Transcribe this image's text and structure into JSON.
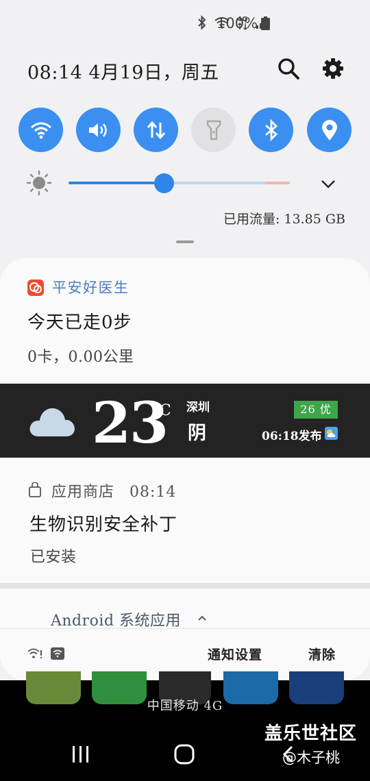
{
  "status_bar": {
    "battery_text": "100%",
    "icons": [
      "bluetooth-icon",
      "wifi-icon",
      "4g-icon",
      "signal-icon",
      "battery-icon"
    ]
  },
  "header": {
    "datetime": "08:14 4月19日，周五"
  },
  "quick_settings": {
    "tiles": [
      {
        "name": "wifi",
        "icon": "wifi-icon",
        "on": true
      },
      {
        "name": "sound",
        "icon": "speaker-icon",
        "on": true
      },
      {
        "name": "mobile-data",
        "icon": "data-arrows-icon",
        "on": true
      },
      {
        "name": "flashlight",
        "icon": "flashlight-icon",
        "on": false
      },
      {
        "name": "bluetooth",
        "icon": "bluetooth-icon",
        "on": true
      },
      {
        "name": "location",
        "icon": "location-pin-icon",
        "on": true
      }
    ],
    "brightness_level": 0.43,
    "data_usage": "已用流量: 13.85 GB"
  },
  "notifications": {
    "health": {
      "app": "平安好医生",
      "title": "今天已走0步",
      "text": "0卡，0.00公里"
    },
    "weather": {
      "temperature": "23",
      "unit": "°C",
      "city": "深圳",
      "condition": "阴",
      "aqi": "26 优",
      "published": "06:18发布"
    },
    "store": {
      "app": "应用商店",
      "time": "08:14",
      "title": "生物识别安全补丁",
      "text": "已安装"
    },
    "group": {
      "label": "Android 系统应用"
    }
  },
  "footer": {
    "settings_label": "通知设置",
    "clear_label": "清除"
  },
  "home": {
    "carrier": "中国移动 4G"
  },
  "watermark": {
    "line1": "盖乐世社区",
    "line2": "@木子桃"
  },
  "colors": {
    "accent": "#3b8ff0",
    "tile_off": "#e1e1e3",
    "weather_bg": "#232323",
    "aqi_green": "#3ea54a"
  }
}
